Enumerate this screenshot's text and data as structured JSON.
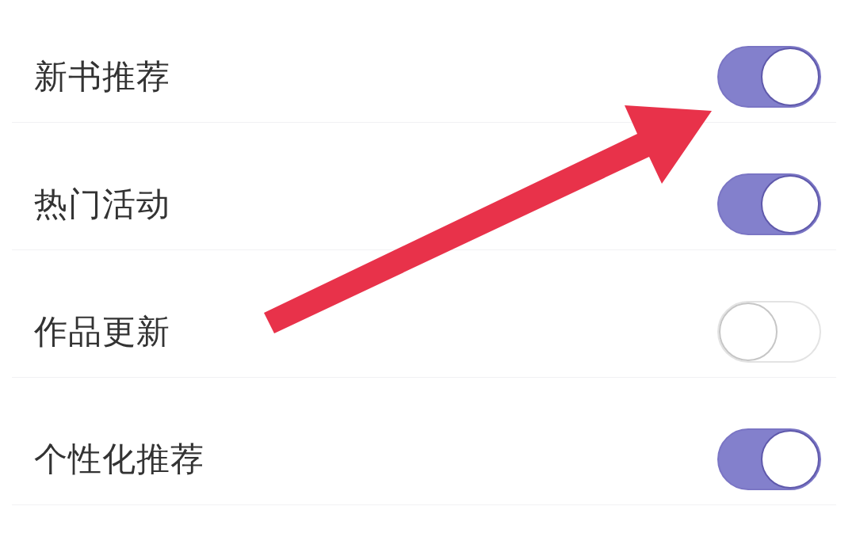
{
  "settings": [
    {
      "label": "新书推荐",
      "on": true
    },
    {
      "label": "热门活动",
      "on": true
    },
    {
      "label": "作品更新",
      "on": false
    },
    {
      "label": "个性化推荐",
      "on": true
    }
  ]
}
